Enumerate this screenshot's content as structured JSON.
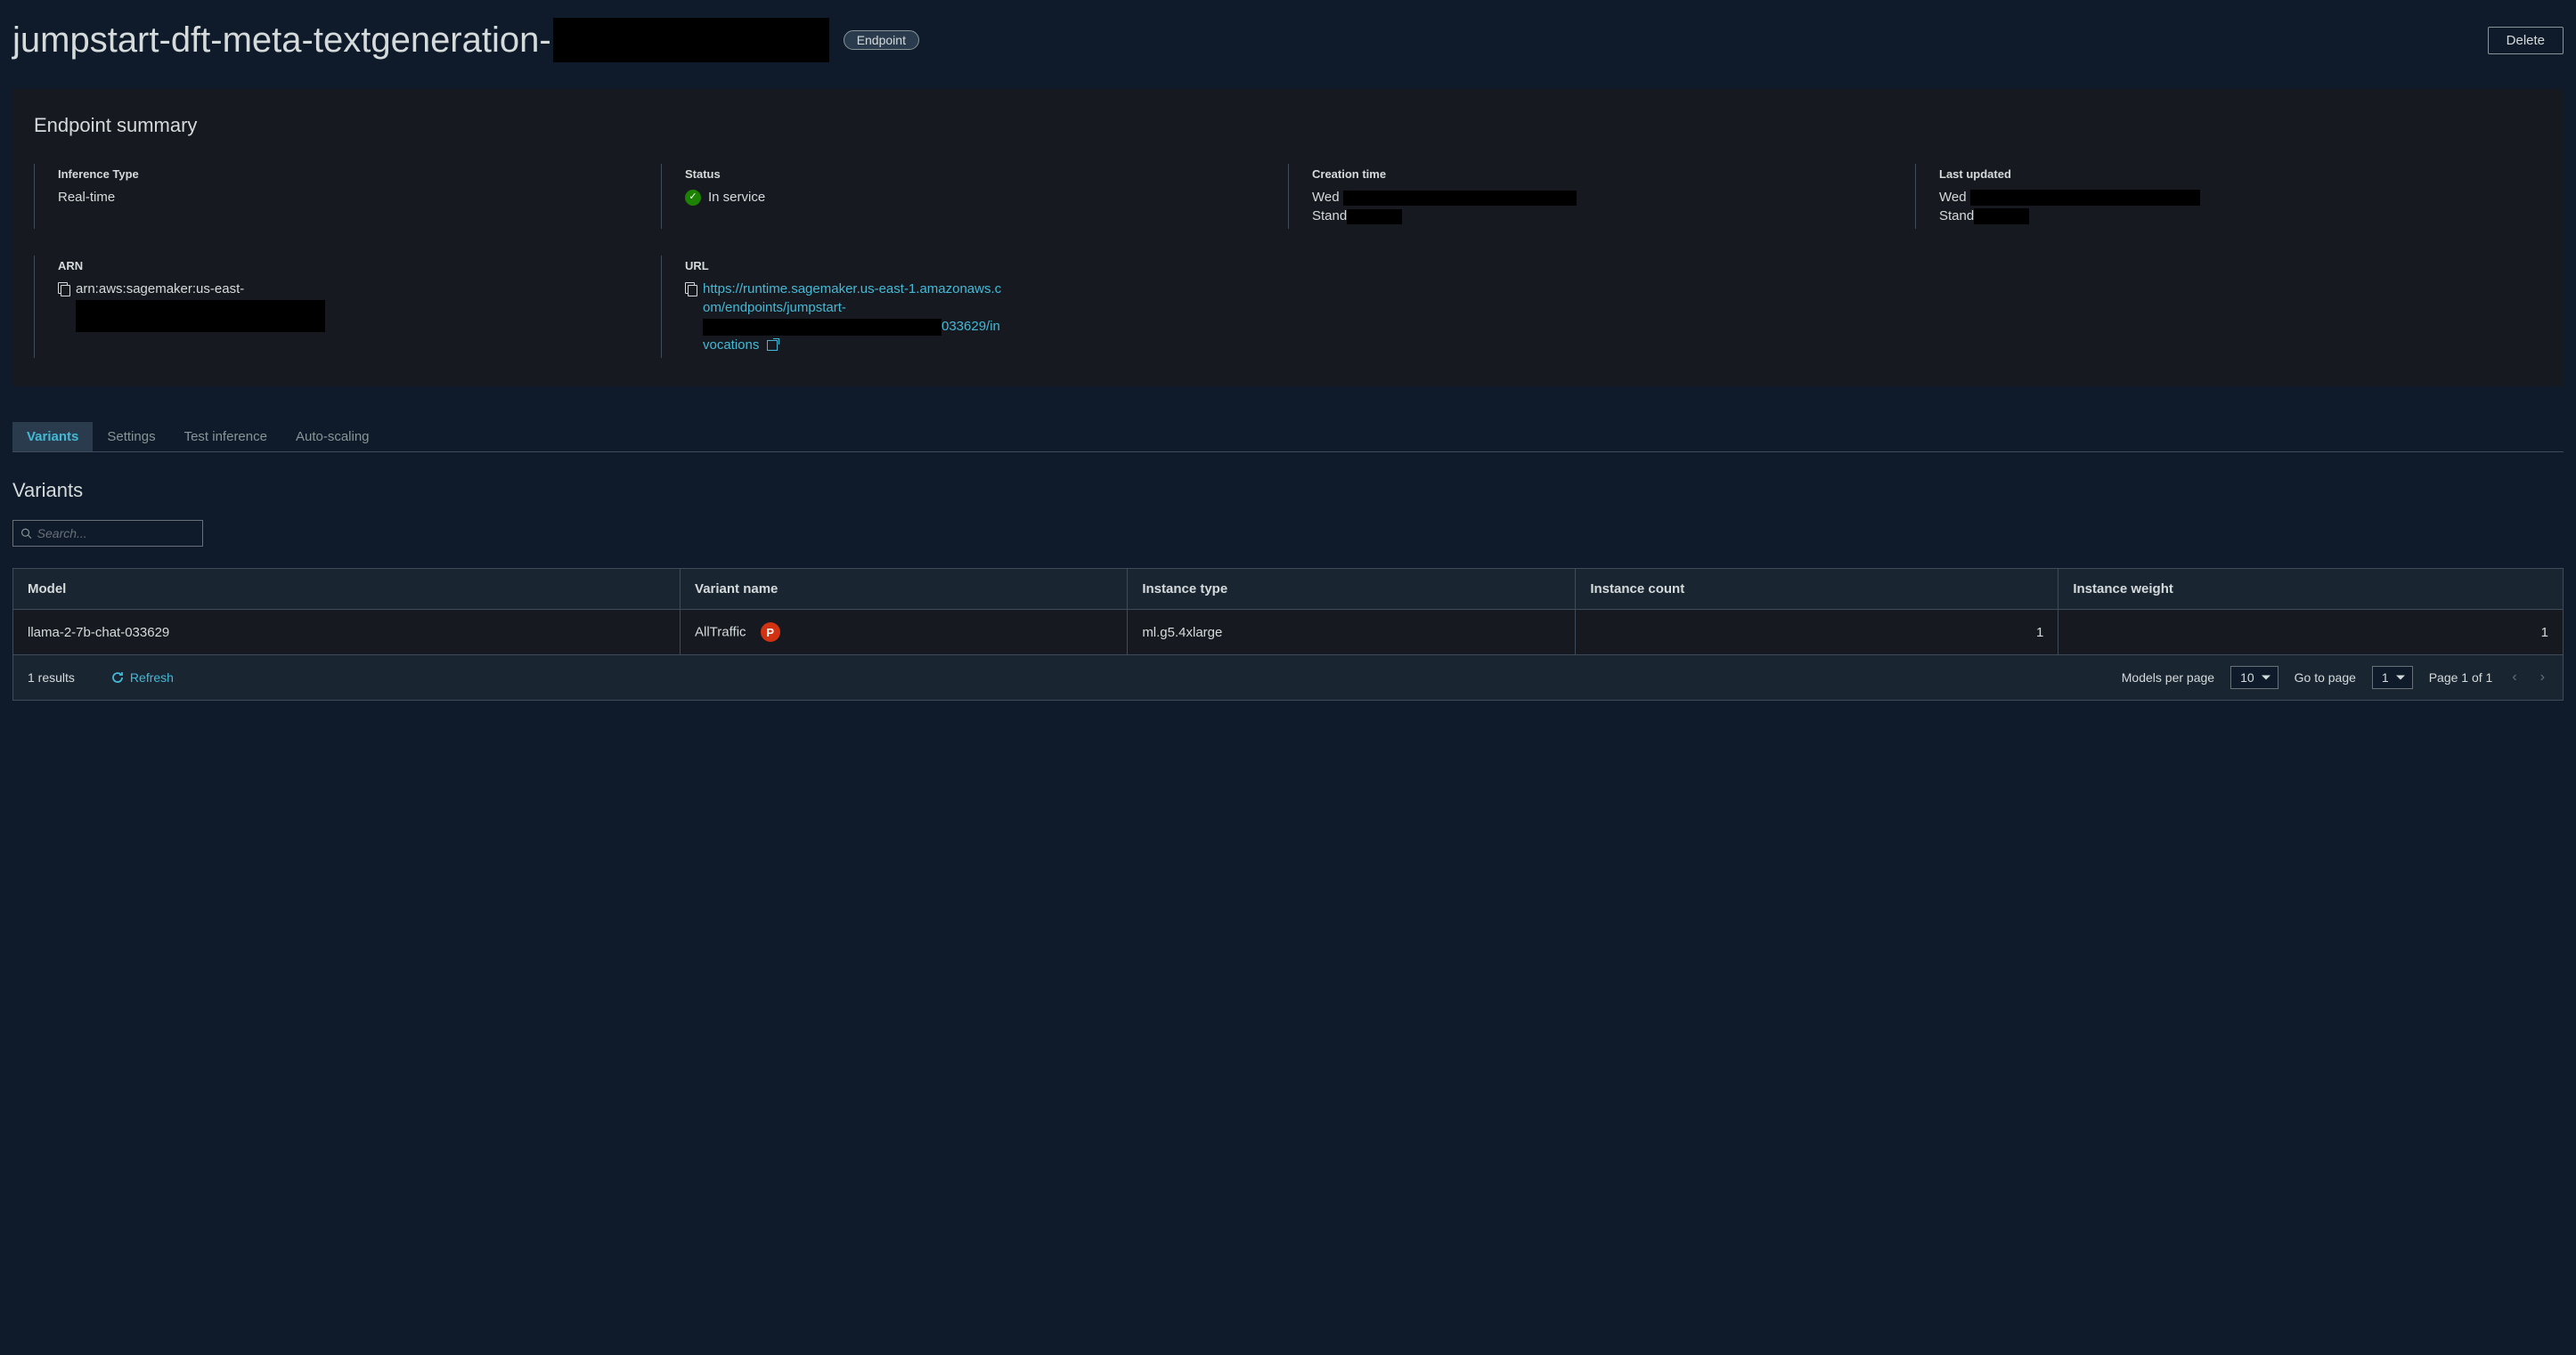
{
  "header": {
    "title_prefix": "jumpstart-dft-meta-textgeneration-",
    "badge": "Endpoint",
    "delete_label": "Delete"
  },
  "summary": {
    "panel_title": "Endpoint summary",
    "inference_type": {
      "label": "Inference Type",
      "value": "Real-time"
    },
    "status": {
      "label": "Status",
      "value": "In service"
    },
    "creation_time": {
      "label": "Creation time",
      "line1_prefix": "Wed ",
      "line2_prefix": "Stand"
    },
    "last_updated": {
      "label": "Last updated",
      "line1_prefix": "Wed ",
      "line2_prefix": "Stand"
    },
    "arn": {
      "label": "ARN",
      "prefix": "arn:aws:sagemaker:us-east-"
    },
    "url": {
      "label": "URL",
      "line1": "https://runtime.sagemaker.us-east-1.amazonaws.com/endpoints/jumpstart-",
      "line3": "033629/invocations"
    }
  },
  "tabs": [
    "Variants",
    "Settings",
    "Test inference",
    "Auto-scaling"
  ],
  "variants": {
    "section_title": "Variants",
    "search_placeholder": "Search...",
    "columns": [
      "Model",
      "Variant name",
      "Instance type",
      "Instance count",
      "Instance weight"
    ],
    "rows": [
      {
        "model": "llama-2-7b-chat-033629",
        "variant_name": "AllTraffic",
        "variant_badge": "P",
        "instance_type": "ml.g5.4xlarge",
        "instance_count": "1",
        "instance_weight": "1"
      }
    ],
    "footer": {
      "results": "1 results",
      "refresh": "Refresh",
      "models_per_page_label": "Models per page",
      "models_per_page_value": "10",
      "go_to_page_label": "Go to page",
      "go_to_page_value": "1",
      "page_info": "Page 1 of 1"
    }
  }
}
